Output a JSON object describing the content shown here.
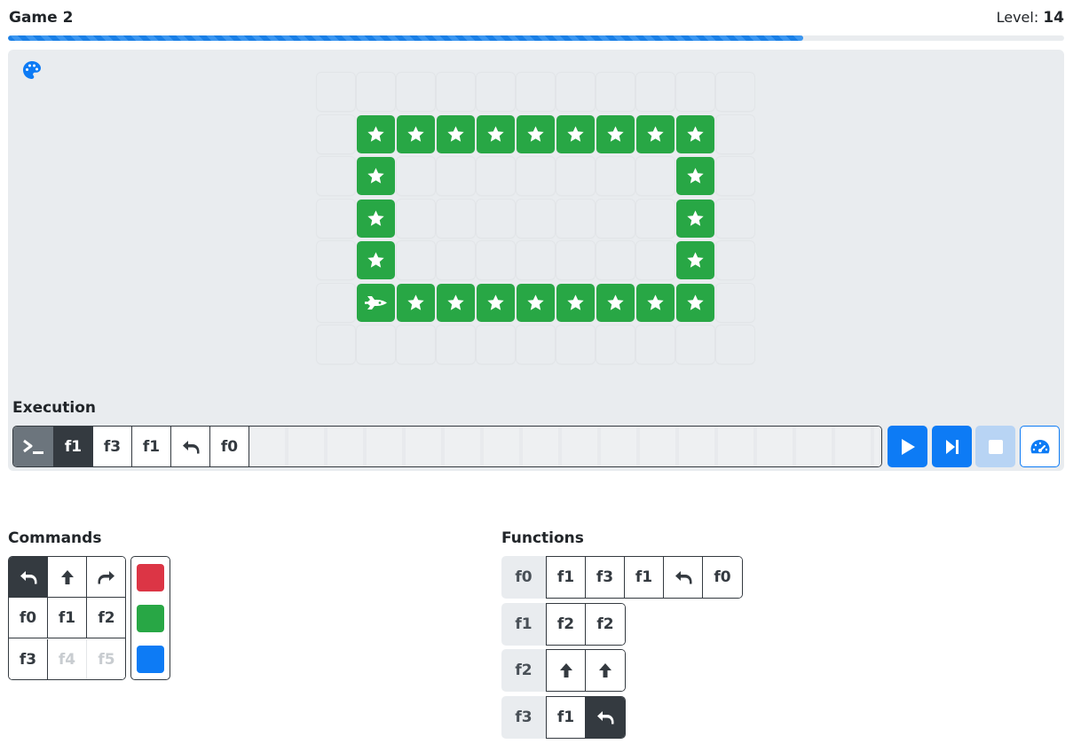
{
  "header": {
    "title": "Game 2",
    "level_label": "Level:",
    "level_value": "14"
  },
  "progress": {
    "fraction": 0.753
  },
  "board": {
    "rows": 7,
    "cols": 11,
    "green_cells": [
      [
        1,
        1
      ],
      [
        1,
        2
      ],
      [
        1,
        3
      ],
      [
        1,
        4
      ],
      [
        1,
        5
      ],
      [
        1,
        6
      ],
      [
        1,
        7
      ],
      [
        1,
        8
      ],
      [
        1,
        9
      ],
      [
        2,
        1
      ],
      [
        2,
        9
      ],
      [
        3,
        1
      ],
      [
        3,
        9
      ],
      [
        4,
        1
      ],
      [
        4,
        9
      ],
      [
        5,
        1
      ],
      [
        5,
        2
      ],
      [
        5,
        3
      ],
      [
        5,
        4
      ],
      [
        5,
        5
      ],
      [
        5,
        6
      ],
      [
        5,
        7
      ],
      [
        5,
        8
      ],
      [
        5,
        9
      ]
    ],
    "ship_cell": [
      5,
      1
    ],
    "cell_icon": "star-icon",
    "ship_icon": "spaceship-icon",
    "colors": {
      "green": "#28a745",
      "empty": "#e9ecef"
    }
  },
  "execution": {
    "label": "Execution",
    "terminal_icon": "terminal-icon",
    "queue": [
      {
        "text": "f1",
        "state": "active"
      },
      {
        "text": "f3"
      },
      {
        "text": "f1"
      },
      {
        "icon": "turn-left-icon"
      },
      {
        "text": "f0"
      }
    ],
    "controls": [
      "play-icon",
      "step-forward-icon",
      "stop-icon",
      "speedometer-icon"
    ]
  },
  "commands": {
    "label": "Commands",
    "items": [
      {
        "icon": "turn-left-icon",
        "state": "selected"
      },
      {
        "icon": "arrow-up-icon"
      },
      {
        "icon": "turn-right-icon"
      },
      {
        "text": "f0"
      },
      {
        "text": "f1"
      },
      {
        "text": "f2"
      },
      {
        "text": "f3"
      },
      {
        "text": "f4",
        "state": "disabled"
      },
      {
        "text": "f5",
        "state": "disabled"
      }
    ],
    "colors": [
      "#dc3545",
      "#28a745",
      "#0d7bf5"
    ]
  },
  "functions": {
    "label": "Functions",
    "rows": [
      {
        "name": "f0",
        "slots": [
          {
            "text": "f1"
          },
          {
            "text": "f3"
          },
          {
            "text": "f1"
          },
          {
            "icon": "turn-left-icon"
          },
          {
            "text": "f0"
          }
        ]
      },
      {
        "name": "f1",
        "slots": [
          {
            "text": "f2"
          },
          {
            "text": "f2"
          }
        ]
      },
      {
        "name": "f2",
        "slots": [
          {
            "icon": "arrow-up-icon"
          },
          {
            "icon": "arrow-up-icon"
          }
        ]
      },
      {
        "name": "f3",
        "slots": [
          {
            "text": "f1"
          },
          {
            "icon": "turn-left-icon",
            "state": "dark"
          }
        ]
      }
    ]
  }
}
